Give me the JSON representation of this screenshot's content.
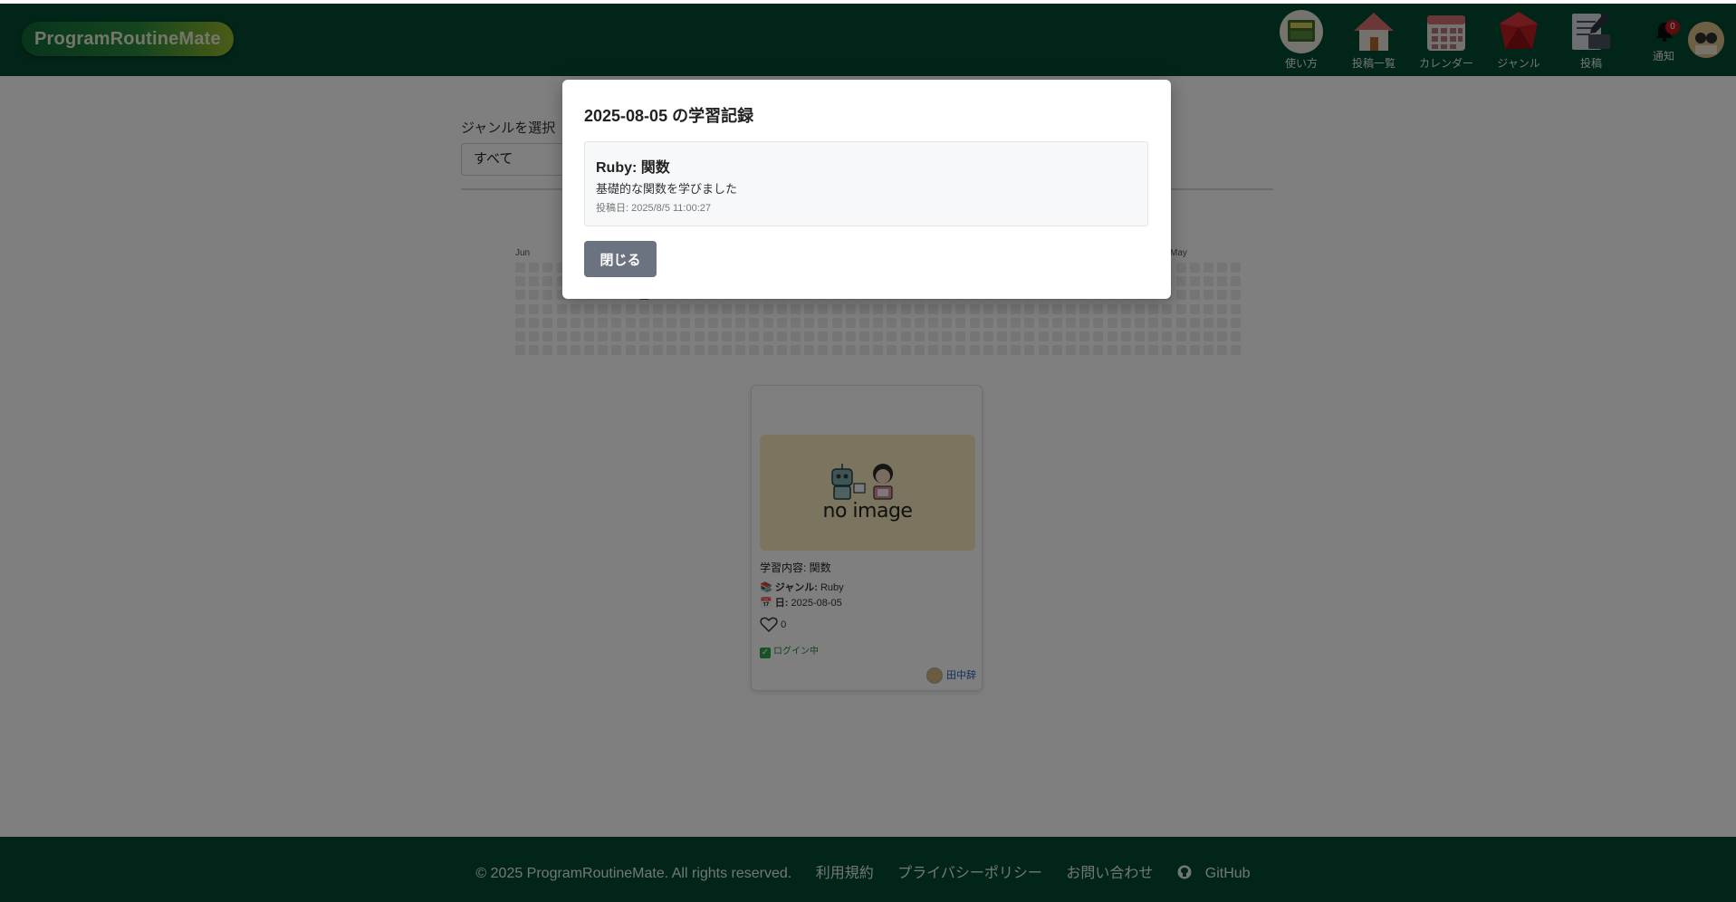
{
  "header": {
    "logo": "ProgramRoutineMate",
    "nav": [
      {
        "label": "使い方",
        "icon": "book-icon"
      },
      {
        "label": "投稿一覧",
        "icon": "home-icon"
      },
      {
        "label": "カレンダー",
        "icon": "calendar-icon"
      },
      {
        "label": "ジャンル",
        "icon": "ruby-icon"
      },
      {
        "label": "投稿",
        "icon": "post-icon"
      }
    ],
    "notifications": {
      "label": "通知",
      "count": "0",
      "icon": "bell-icon"
    },
    "avatar": {
      "icon": "user-avatar-icon"
    }
  },
  "filter": {
    "label": "ジャンルを選択",
    "selected": "すべて"
  },
  "heatmap": {
    "months": [
      "Jun",
      "May"
    ],
    "active_color": "#3b9a36",
    "empty_color": "#eaeaea",
    "active_dates": [
      "2025-08-05"
    ]
  },
  "card": {
    "image_text": "no image",
    "content": "学習内容: 関数",
    "genre_label": "ジャンル:",
    "genre_value": "Ruby",
    "date_label": "日:",
    "date_value": "2025-08-05",
    "likes": "0",
    "status": "ログイン中",
    "author": "田中辞"
  },
  "footer": {
    "copyright": "© 2025 ProgramRoutineMate. All rights reserved.",
    "links": [
      "利用規約",
      "プライバシーポリシー",
      "お問い合わせ",
      "GitHub"
    ]
  },
  "modal": {
    "title": "2025-08-05 の学習記録",
    "entry_title": "Ruby: 関数",
    "entry_body": "基礎的な関数を学びました",
    "entry_date": "投稿日: 2025/8/5 11:00:27",
    "close_label": "閉じる"
  },
  "colors": {
    "header_bg": "#034a30",
    "close_button_bg": "#6b7380",
    "link_blue": "#1f5fb0"
  }
}
